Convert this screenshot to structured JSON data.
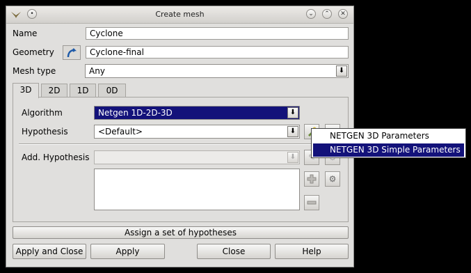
{
  "window": {
    "title": "Create mesh"
  },
  "form": {
    "name_label": "Name",
    "name_value": "Cyclone",
    "geometry_label": "Geometry",
    "geometry_value": "Cyclone-final",
    "mesh_type_label": "Mesh type",
    "mesh_type_value": "Any"
  },
  "tabs": [
    {
      "label": "3D",
      "active": true
    },
    {
      "label": "2D"
    },
    {
      "label": "1D"
    },
    {
      "label": "0D"
    }
  ],
  "panel": {
    "algorithm_label": "Algorithm",
    "algorithm_value": "Netgen 1D-2D-3D",
    "hypothesis_label": "Hypothesis",
    "hypothesis_value": "<Default>",
    "add_hypothesis_label": "Add. Hypothesis",
    "add_hypothesis_value": ""
  },
  "popup_menu": {
    "items": [
      {
        "label": "NETGEN 3D Parameters"
      },
      {
        "label": "NETGEN 3D Simple Parameters",
        "selected": true
      }
    ]
  },
  "buttons": {
    "assign_set": "Assign a set of hypotheses",
    "apply_close": "Apply and Close",
    "apply": "Apply",
    "close": "Close",
    "help": "Help"
  },
  "colors": {
    "selection": "#13127a",
    "window_bg": "#e0dfdd"
  }
}
